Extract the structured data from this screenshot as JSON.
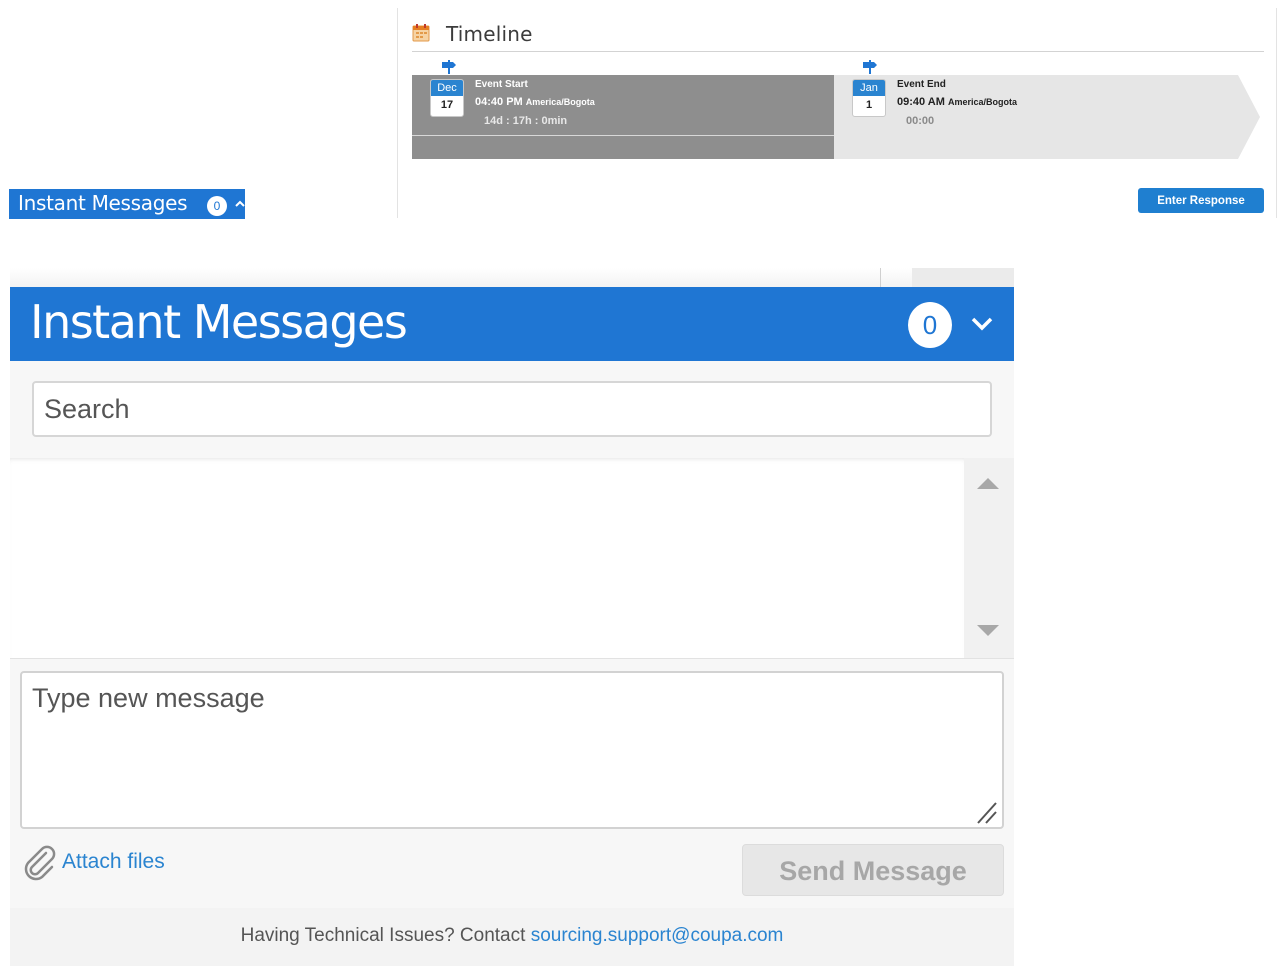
{
  "timeline": {
    "title": "Timeline",
    "start": {
      "month": "Dec",
      "day": "17",
      "label": "Event Start",
      "time": "04:40 PM",
      "timezone": "America/Bogota",
      "remaining": "14d : 17h : 0min"
    },
    "end": {
      "month": "Jan",
      "day": "1",
      "label": "Event End",
      "time": "09:40 AM",
      "timezone": "America/Bogota",
      "remaining": "00:00"
    },
    "progress_percent": 50
  },
  "enter_response_label": "Enter Response",
  "im_mini": {
    "label": "Instant Messages",
    "count": "0"
  },
  "chat": {
    "title": "Instant Messages",
    "count": "0",
    "search_placeholder": "Search",
    "message_placeholder": "Type new message",
    "attach_label": "Attach files",
    "send_label": "Send Message",
    "footer_text": "Having Technical Issues? Contact ",
    "footer_email": "sourcing.support@coupa.com"
  },
  "colors": {
    "brand_blue": "#1f76d3",
    "link_blue": "#2a84d0",
    "timeline_elapsed": "#8e8e8e",
    "timeline_remaining": "#e6e6e6"
  },
  "icons": {
    "calendar": "calendar-icon",
    "flag": "flag-icon",
    "chevron_up": "chevron-up-icon",
    "chevron_down": "chevron-down-icon",
    "paperclip": "paperclip-icon",
    "arrow_up": "scroll-up-arrow-icon",
    "arrow_down": "scroll-down-arrow-icon"
  }
}
